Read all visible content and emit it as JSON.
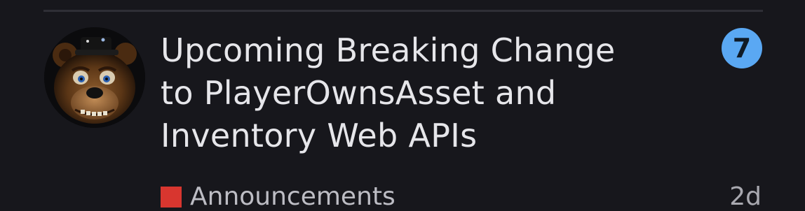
{
  "topic": {
    "title": "Upcoming Breaking Change to PlayerOwnsAsset and Inventory Web APIs",
    "reply_count": "7",
    "category": {
      "name": "Announcements",
      "color": "#d8362f"
    },
    "activity_age": "2d",
    "avatar_icon": "bear-avatar-icon"
  },
  "colors": {
    "background": "#17171c",
    "divider": "#2f2f36",
    "badge": "#5aa8f3",
    "title_text": "#e6e6ea",
    "muted_text": "#bdbdc4"
  }
}
